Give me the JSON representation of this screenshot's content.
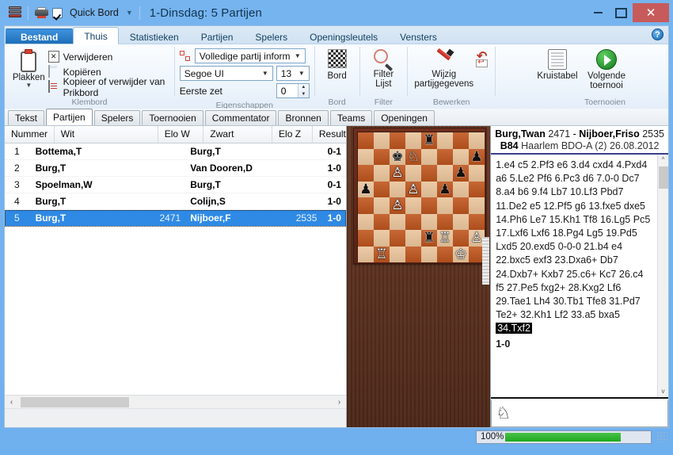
{
  "titlebar": {
    "db_icon": "database-icon",
    "print_icon": "printer-icon",
    "quick_board_label": "Quick Bord",
    "quick_board_checked": true,
    "dropdown_icon": "chevron-down-icon",
    "title": "1-Dinsdag:  5 Partijen",
    "minimize": "minimize-icon",
    "maximize": "maximize-icon",
    "close": "✕"
  },
  "ribbon": {
    "tabs": [
      {
        "label": "Bestand",
        "kind": "file"
      },
      {
        "label": "Thuis",
        "active": true
      },
      {
        "label": "Statistieken"
      },
      {
        "label": "Partijen"
      },
      {
        "label": "Spelers"
      },
      {
        "label": "Openingsleutels"
      },
      {
        "label": "Vensters"
      }
    ],
    "help_label": "?",
    "groups": {
      "klembord": {
        "label": "Klembord",
        "paste_label": "Plakken",
        "paste_caret": "▼",
        "items": [
          {
            "label": "Verwijderen",
            "icon": "delete-icon"
          },
          {
            "label": "Kopiëren",
            "icon": "copy-icon"
          },
          {
            "label": "Kopieer of verwijder van Prikbord",
            "icon": "clipboard-list-icon"
          }
        ]
      },
      "eigenschappen": {
        "label": "Eigenschappen",
        "layout_value": "Volledige partij inform",
        "font_value": "Segoe UI",
        "fontsize_value": "13",
        "firstmove_label": "Eerste zet",
        "firstmove_value": "0"
      },
      "bord": {
        "label": "Bord",
        "button_label": "Bord",
        "icon": "chessboard-icon"
      },
      "filter": {
        "label": "Filter",
        "button_label": "Filter Lijst",
        "icon": "magnifier-icon"
      },
      "bewerken": {
        "label": "Bewerken",
        "button_label": "Wijzig partijgegevens",
        "icon": "pen-icon",
        "undo_icon": "undo-icon"
      },
      "toernooien": {
        "label": "Toernooien",
        "crosstable_label": "Kruistabel",
        "crosstable_icon": "table-icon",
        "next_label": "Volgende toernooi",
        "next_icon": "play-icon"
      }
    }
  },
  "doc_tabs": [
    {
      "label": "Tekst"
    },
    {
      "label": "Partijen",
      "active": true
    },
    {
      "label": "Spelers"
    },
    {
      "label": "Toernooien"
    },
    {
      "label": "Commentator"
    },
    {
      "label": "Bronnen"
    },
    {
      "label": "Teams"
    },
    {
      "label": "Openingen"
    }
  ],
  "game_list": {
    "columns": [
      "Nummer",
      "Wit",
      "Elo W",
      "Zwart",
      "Elo Z",
      "Result"
    ],
    "rows": [
      {
        "nummer": "1",
        "wit": "Bottema,T",
        "elo_w": "",
        "zwart": "Burg,T",
        "elo_z": "",
        "result": "0-1",
        "selected": false
      },
      {
        "nummer": "2",
        "wit": "Burg,T",
        "elo_w": "",
        "zwart": "Van Dooren,D",
        "elo_z": "",
        "result": "1-0",
        "selected": false
      },
      {
        "nummer": "3",
        "wit": "Spoelman,W",
        "elo_w": "",
        "zwart": "Burg,T",
        "elo_z": "",
        "result": "0-1",
        "selected": false
      },
      {
        "nummer": "4",
        "wit": "Burg,T",
        "elo_w": "",
        "zwart": "Colijn,S",
        "elo_z": "",
        "result": "1-0",
        "selected": false
      },
      {
        "nummer": "5",
        "wit": "Burg,T",
        "elo_w": "2471",
        "zwart": "Nijboer,F",
        "elo_z": "2535",
        "result": "1-0",
        "selected": true
      }
    ],
    "hscroll": {
      "left_arrow": "‹",
      "right_arrow": "›"
    }
  },
  "board": {
    "orientation": "white-bottom",
    "pieces": [
      {
        "square": "e8",
        "piece": "black-rook",
        "glyph": "♜"
      },
      {
        "square": "c7",
        "piece": "black-king",
        "glyph": "♚"
      },
      {
        "square": "d7",
        "piece": "white-knight",
        "glyph": "♘"
      },
      {
        "square": "h7",
        "piece": "black-pawn",
        "glyph": "♟"
      },
      {
        "square": "c6",
        "piece": "white-pawn",
        "glyph": "♙"
      },
      {
        "square": "g6",
        "piece": "black-pawn",
        "glyph": "♟"
      },
      {
        "square": "a5",
        "piece": "black-pawn",
        "glyph": "♟"
      },
      {
        "square": "d5",
        "piece": "white-pawn",
        "glyph": "♙"
      },
      {
        "square": "f5",
        "piece": "black-pawn",
        "glyph": "♟"
      },
      {
        "square": "c4",
        "piece": "white-pawn",
        "glyph": "♙"
      },
      {
        "square": "e2",
        "piece": "black-rook",
        "glyph": "♜"
      },
      {
        "square": "f2",
        "piece": "white-rook",
        "glyph": "♖"
      },
      {
        "square": "h2",
        "piece": "white-pawn",
        "glyph": "♙"
      },
      {
        "square": "b1",
        "piece": "white-rook",
        "glyph": "♖"
      },
      {
        "square": "g1",
        "piece": "white-king",
        "glyph": "♔"
      }
    ]
  },
  "notation": {
    "white_name": "Burg,Twan",
    "white_elo": "2471",
    "dash": "-",
    "black_name": "Nijboer,Friso",
    "black_elo": "2535",
    "eco": "B84",
    "event": "Haarlem BDO-A (2) 26.08.2012",
    "moves_text": "1.e4 c5 2.Pf3 e6 3.d4 cxd4 4.Pxd4 a6 5.Le2 Pf6 6.Pc3 d6 7.0-0 Dc7 8.a4 b6 9.f4 Lb7 10.Lf3 Pbd7 11.De2 e5 12.Pf5 g6 13.fxe5 dxe5 14.Ph6 Le7 15.Kh1 Tf8 16.Lg5 Pc5 17.Lxf6 Lxf6 18.Pg4 Lg5 19.Pd5 Lxd5 20.exd5 0-0-0 21.b4 e4 22.bxc5 exf3 23.Dxa6+ Db7 24.Dxb7+ Kxb7 25.c6+ Kc7 26.c4 f5 27.Pe5 fxg2+ 28.Kxg2 Lf6 29.Tae1 Lh4 30.Tb1 Tfe8 31.Pd7 Te2+ 32.Kh1 Lf2 33.a5 bxa5",
    "current_move": "34.Txf2",
    "result": "1-0",
    "scroll_up": "^",
    "scroll_down": "v",
    "knight_icon": "knight-icon"
  },
  "statusbar": {
    "percent": "100%",
    "progress_value": 100,
    "progress_color": "#1da81d",
    "grip": "resize-grip"
  }
}
